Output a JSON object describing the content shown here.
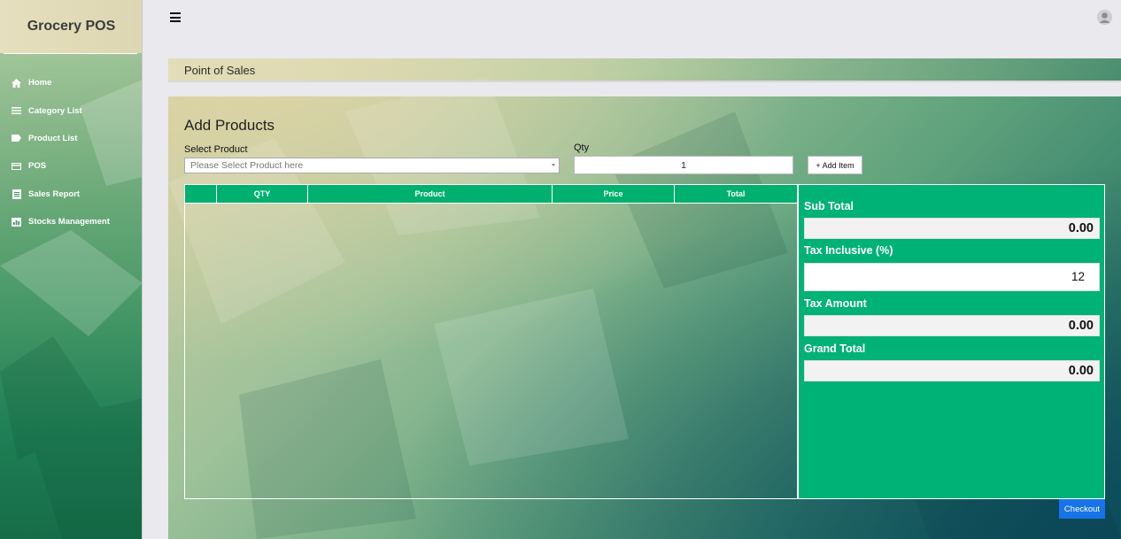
{
  "app": {
    "brand": "Grocery POS"
  },
  "sidebar": {
    "items": [
      {
        "label": "Home",
        "icon": "home-icon"
      },
      {
        "label": "Category List",
        "icon": "list-icon"
      },
      {
        "label": "Product List",
        "icon": "tag-icon"
      },
      {
        "label": "POS",
        "icon": "credit-card-icon"
      },
      {
        "label": "Sales Report",
        "icon": "document-icon"
      },
      {
        "label": "Stocks Management",
        "icon": "bar-chart-icon"
      }
    ]
  },
  "topbar": {
    "menu_icon": "hamburger-icon",
    "user_icon": "user-avatar-icon"
  },
  "page": {
    "title": "Point of Sales"
  },
  "form": {
    "section_title": "Add Products",
    "product_label": "Select Product",
    "product_placeholder": "Please Select Product here",
    "qty_label": "Qty",
    "qty_value": "1",
    "add_button": "+ Add Item"
  },
  "table": {
    "columns": [
      "",
      "QTY",
      "Product",
      "Price",
      "Total"
    ],
    "rows": []
  },
  "summary": {
    "subtotal_label": "Sub Total",
    "subtotal_value": "0.00",
    "tax_label": "Tax Inclusive (%)",
    "tax_value": "12",
    "tax_amount_label": "Tax Amount",
    "tax_amount_value": "0.00",
    "grand_total_label": "Grand Total",
    "grand_total_value": "0.00"
  },
  "actions": {
    "checkout": "Checkout"
  },
  "colors": {
    "accent_green": "#00b276",
    "checkout_blue": "#1673e8",
    "sidebar_header": "#e6dfbe"
  }
}
